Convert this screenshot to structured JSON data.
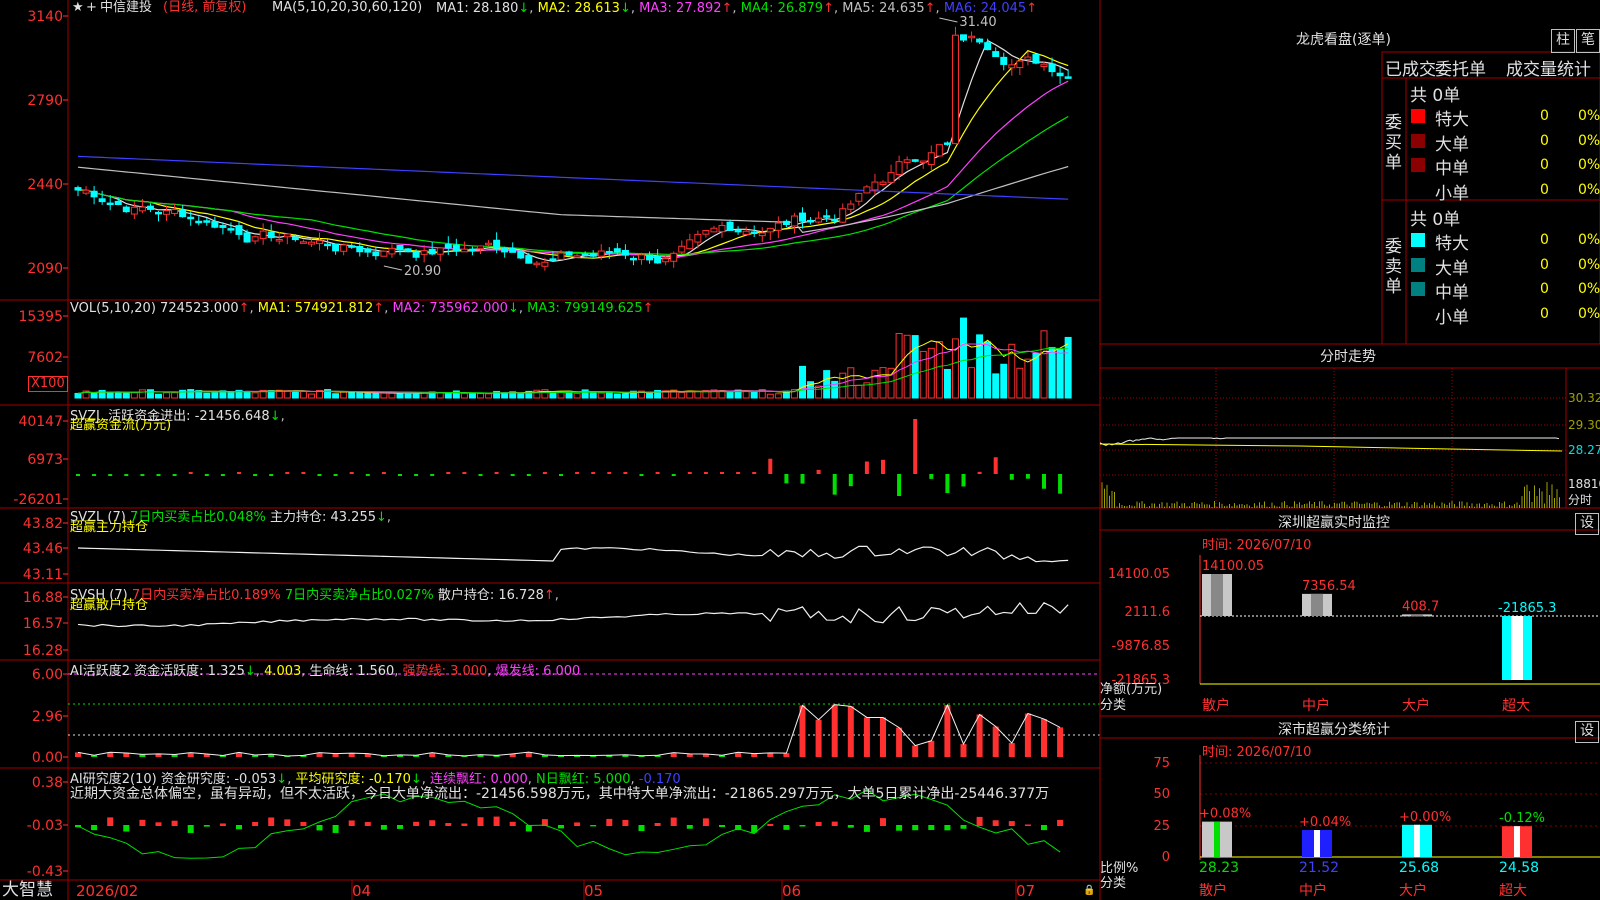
{
  "app": {
    "name": "大智慧",
    "stock": "中信建投",
    "mode": "(日线, 前复权)"
  },
  "colors": {
    "up": "#ff3030",
    "down": "#00ffff",
    "bg": "#000000",
    "grid": "#a00000"
  },
  "main": {
    "ma_header": "MA(5,10,20,30,60,120)",
    "ma": [
      {
        "name": "MA1",
        "value": "28.180",
        "arrow": "↓",
        "color": "#e0e0e0"
      },
      {
        "name": "MA2",
        "value": "28.613",
        "arrow": "↓",
        "color": "#ffff00"
      },
      {
        "name": "MA3",
        "value": "27.892",
        "arrow": "↑",
        "color": "#ff40ff"
      },
      {
        "name": "MA4",
        "value": "26.879",
        "arrow": "↑",
        "color": "#00e000"
      },
      {
        "name": "MA5",
        "value": "24.635",
        "arrow": "↑",
        "color": "#c0c0c0"
      },
      {
        "name": "MA6",
        "value": "24.045",
        "arrow": "↑",
        "color": "#4040ff"
      }
    ],
    "y_ticks": [
      "3140",
      "2790",
      "2440",
      "2090"
    ],
    "high_label": "31.40",
    "low_label": "20.90"
  },
  "vol": {
    "header": "VOL(5,10,20)",
    "value": "724523.000",
    "ma": [
      {
        "name": "MA1",
        "value": "574921.812",
        "arrow": "↑"
      },
      {
        "name": "MA2",
        "value": "735962.000",
        "arrow": "↓"
      },
      {
        "name": "MA3",
        "value": "799149.625",
        "arrow": "↑"
      }
    ],
    "y_ticks": [
      "15395",
      "7602"
    ],
    "unit": "X100"
  },
  "svzj": {
    "title": "SVZJ",
    "label": "活跃资金进出:",
    "value": "-21456.648",
    "arrow": "↓",
    "sub": "超赢资金流(万元)",
    "y_ticks": [
      "40147",
      "6973",
      "-26201"
    ]
  },
  "svzl": {
    "title": "SVZL (7)",
    "text1": "7日内买卖占比0.048%",
    "text2": "主力持仓:",
    "value": "43.255",
    "arrow": "↓",
    "sub": "超赢主力持仓",
    "y_ticks": [
      "43.82",
      "43.46",
      "43.11"
    ]
  },
  "svsh": {
    "title": "SVSH (7)",
    "text1": "7日内买卖净占比0.189%",
    "text2": "7日内买卖净占比0.027%",
    "text3": "散户持仓:",
    "value": "16.728",
    "arrow": "↑",
    "sub": "超赢散户持仓",
    "y_ticks": [
      "16.88",
      "16.57",
      "16.28"
    ]
  },
  "ai1": {
    "title": "AI活跃度2",
    "label": "资金活跃度:",
    "v1": "1.325",
    "v2": "4.003",
    "life_label": "生命线:",
    "life": "1.560",
    "strong": "强势线: 3.000",
    "burst": "爆发线: 6.000",
    "y_ticks": [
      "6.00",
      "2.96",
      "0.00"
    ]
  },
  "ai2": {
    "title": "AI研究度2(10)",
    "label": "资金研究度:",
    "v1": "-0.053",
    "avg": "平均研究度: -0.170",
    "streak": "连续飘红: 0.000",
    "nday": "N日飘红: 5.000",
    "last": "-0.170",
    "comment": "近期大资金总体偏空，虽有异动，但不太活跃，今日大单净流出：-21456.598万元，其中特大单净流出：-21865.297万元，大单5日累计净出-25446.377万",
    "y_ticks": [
      "0.38",
      "-0.03",
      "-0.43"
    ]
  },
  "x_axis": [
    "2026/02",
    "04",
    "05",
    "06",
    "07"
  ],
  "right": {
    "title": "龙虎看盘(逐单)",
    "btn_pillar": "柱",
    "btn_note": "笔",
    "tabs": [
      "已成交",
      "委托单",
      "成交量统计"
    ],
    "buy_side": "委买单",
    "sell_side": "委卖单",
    "total_buy": "共 0单",
    "total_sell": "共 0单",
    "rows": [
      {
        "name": "特大",
        "count": "0",
        "pct": "0%"
      },
      {
        "name": "大单",
        "count": "0",
        "pct": "0%"
      },
      {
        "name": "中单",
        "count": "0",
        "pct": "0%"
      },
      {
        "name": "小单",
        "count": "0",
        "pct": "0%"
      }
    ],
    "intraday_title": "分时走势",
    "intraday_ticks": [
      "30.32",
      "29.30",
      "28.27"
    ],
    "intraday_vol": "18810",
    "intraday_label": "分时",
    "sz_title": "深圳超赢实时监控",
    "sz_set": "设",
    "time_label": "时间: 2026/07/10",
    "net_ticks": [
      "14100.05",
      "2111.6",
      "-9876.85",
      "-21865.3"
    ],
    "net_unit": "净额(万元)",
    "cat_label": "分类",
    "net_values": [
      {
        "cat": "散户",
        "value": "14100.05"
      },
      {
        "cat": "中户",
        "value": "7356.54"
      },
      {
        "cat": "大户",
        "value": "408.7"
      },
      {
        "cat": "超大",
        "value": "-21865.3"
      }
    ],
    "cls_title": "深市超赢分类统计",
    "cls_set": "设",
    "cls_ticks": [
      "75",
      "50",
      "25",
      "0"
    ],
    "ratio_label": "比例%",
    "cls_values": [
      {
        "cat": "散户",
        "pct": "28.23",
        "chg": "+0.08%"
      },
      {
        "cat": "中户",
        "pct": "21.52",
        "chg": "+0.04%"
      },
      {
        "cat": "大户",
        "pct": "25.68",
        "chg": "+0.00%"
      },
      {
        "cat": "超大",
        "pct": "24.58",
        "chg": "-0.12%"
      }
    ]
  },
  "chart_data": {
    "type": "candlestick",
    "title": "中信建投",
    "period": "日线, 前复权",
    "x_labels": [
      "2026/02",
      "04",
      "05",
      "06",
      "07"
    ],
    "ylim": [
      2090,
      3140
    ],
    "series": [
      {
        "name": "MA1",
        "last": 28.18
      },
      {
        "name": "MA2",
        "last": 28.613
      },
      {
        "name": "MA3",
        "last": 27.892
      },
      {
        "name": "MA4",
        "last": 26.879
      },
      {
        "name": "MA5",
        "last": 24.635
      },
      {
        "name": "MA6",
        "last": 24.045
      }
    ],
    "annotations": [
      {
        "label": "31.40",
        "type": "high"
      },
      {
        "label": "20.90",
        "type": "low"
      }
    ]
  }
}
